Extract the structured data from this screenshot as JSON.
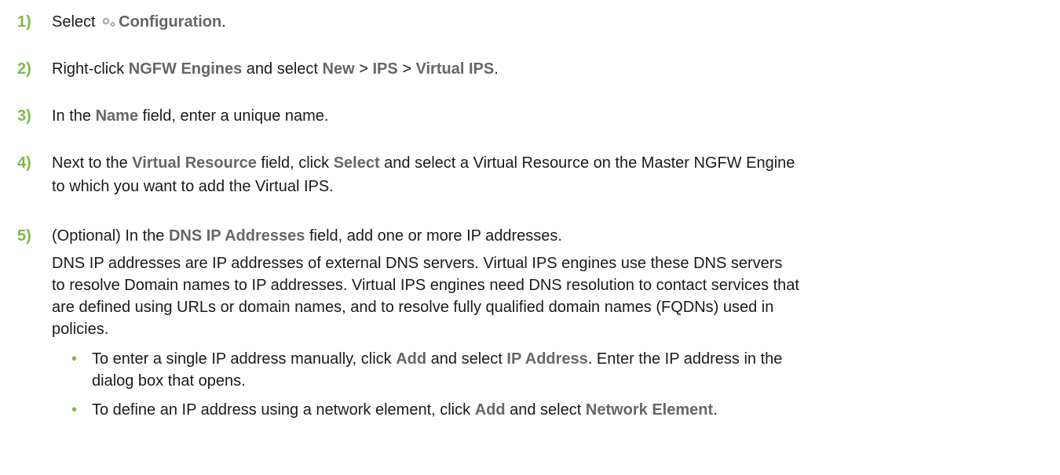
{
  "steps": [
    {
      "number": "1)",
      "lines": [
        {
          "parts": [
            "Select ",
            "Configuration",
            "."
          ]
        }
      ],
      "icon": "gears-icon"
    },
    {
      "number": "2)",
      "lines": [
        {
          "parts": [
            "Right-click ",
            "NGFW Engines",
            " and select ",
            "New",
            " > ",
            "IPS",
            " > ",
            "Virtual IPS",
            "."
          ]
        }
      ]
    },
    {
      "number": "3)",
      "lines": [
        {
          "parts": [
            "In the ",
            "Name",
            " field, enter a unique name."
          ]
        }
      ]
    },
    {
      "number": "4)",
      "lines": [
        {
          "parts": [
            "Next to the ",
            "Virtual Resource",
            " field, click ",
            "Select",
            " and select a Virtual Resource on the Master NGFW Engine"
          ]
        },
        {
          "parts": [
            "to which you want to add the Virtual IPS."
          ]
        }
      ]
    },
    {
      "number": "5)",
      "lines": [
        {
          "parts": [
            "(Optional) In the ",
            "DNS IP Addresses",
            " field, add one or more IP addresses."
          ]
        }
      ],
      "paragraph": [
        "DNS IP addresses are IP addresses of external DNS servers. Virtual IPS engines use these DNS servers",
        "to resolve Domain names to IP addresses. Virtual IPS engines need DNS resolution to contact services that",
        "are defined using URLs or domain names, and to resolve fully qualified domain names (FQDNs) used in",
        "policies."
      ],
      "bullets": [
        {
          "lines": [
            {
              "parts": [
                "To enter a single IP address manually, click ",
                "Add",
                " and select ",
                "IP Address",
                ". Enter the IP address in the"
              ]
            },
            {
              "parts": [
                "dialog box that opens."
              ]
            }
          ]
        },
        {
          "lines": [
            {
              "parts": [
                "To define an IP address using a network element, click ",
                "Add",
                " and select ",
                "Network Element",
                "."
              ]
            }
          ]
        }
      ]
    }
  ],
  "bullet_glyph": "•",
  "colors": {
    "step_number": "#7dbb42",
    "ui_term": "#666666",
    "text": "#1a1a1a"
  }
}
